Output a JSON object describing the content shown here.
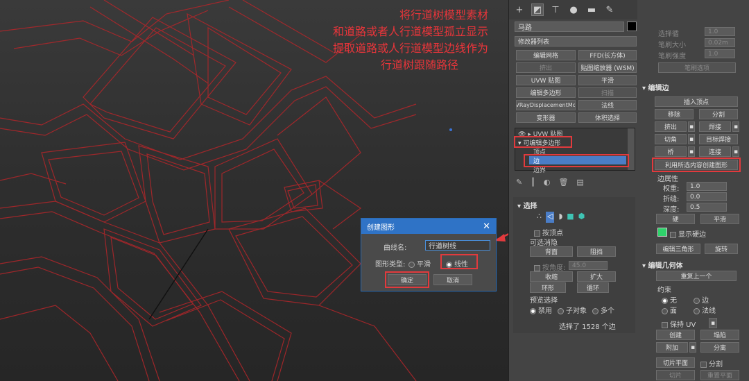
{
  "annotation": {
    "line1": "将行道树模型素材",
    "line2": "和道路或者人行道模型孤立显示",
    "line3": "提取道路或人行道模型边线作为",
    "line4": "行道树跟随路径"
  },
  "panel": {
    "object_name": "马路",
    "modifier_list": "修改器列表",
    "modifier_buttons": [
      "编辑网格",
      "FFD(长方体)",
      "挤出",
      "贴图缩放器 (WSM)",
      "UVW 贴图",
      "平滑",
      "编辑多边形",
      "扫描",
      "VRayDisplacementMo",
      "法线",
      "变形器",
      "体积选择"
    ],
    "stack_items": [
      "UVW 贴图",
      "可编辑多边形",
      "顶点",
      "边",
      "边界"
    ],
    "selection": {
      "header": "选择",
      "by_vertex": "按顶点",
      "ignore_backface": "可选消隐",
      "backface": "背面",
      "occluded": "阻挡",
      "angle_label": "按角度:",
      "angle_value": "45.0",
      "shrink": "收缩",
      "grow": "扩大",
      "ring": "环形",
      "loop": "循环",
      "preview_label": "预览选择",
      "disabled": "禁用",
      "subobject": "子对象",
      "multi": "多个",
      "status": "选择了 1528 个边"
    },
    "soft": {
      "pinch": "选择循",
      "weight": "笔刷大小",
      "strength": "笔刷强度",
      "v1": "1.0",
      "v2": "0.02m",
      "v3": "1.0",
      "brush": "笔刷选项"
    },
    "edit_edges": {
      "header": "编辑边",
      "insert_vertex": "插入顶点",
      "remove": "移除",
      "split": "分割",
      "extrude": "挤出",
      "weld": "焊接",
      "chamfer": "切角",
      "target_weld": "目标焊接",
      "bridge": "桥",
      "connect": "连接",
      "create_shape": "利用所选内容创建图形",
      "edge_props": "边属性",
      "weight": "权重:",
      "weight_v": "1.0",
      "crease": "折缝:",
      "crease_v": "0.0",
      "depth": "深度:",
      "depth_v": "0.5",
      "hard": "硬",
      "smooth": "平滑",
      "show_hard": "显示硬边",
      "edit_tri": "编辑三角形",
      "turn": "旋转"
    },
    "edit_geom": {
      "header": "编辑几何体",
      "repeat": "重复上一个",
      "constraint": "约束",
      "none": "无",
      "edge": "边",
      "face": "面",
      "normal": "法线",
      "preserve_uv": "保持 UV",
      "create": "创建",
      "collapse": "塌陷",
      "attach": "附加",
      "detach": "分离",
      "slice_plane": "切片平面",
      "split": "分割",
      "slice": "切片",
      "reset_plane": "重置平面"
    },
    "colors": {
      "accent": "#e23a3d",
      "dialog_title": "#2f73c6",
      "swatch": "#2fd36b"
    }
  },
  "dialog": {
    "title": "创建图形",
    "curve_label": "曲线名:",
    "curve_value": "行道树线",
    "type_label": "图形类型:",
    "smooth": "平滑",
    "linear": "线性",
    "ok": "确定",
    "cancel": "取消"
  }
}
